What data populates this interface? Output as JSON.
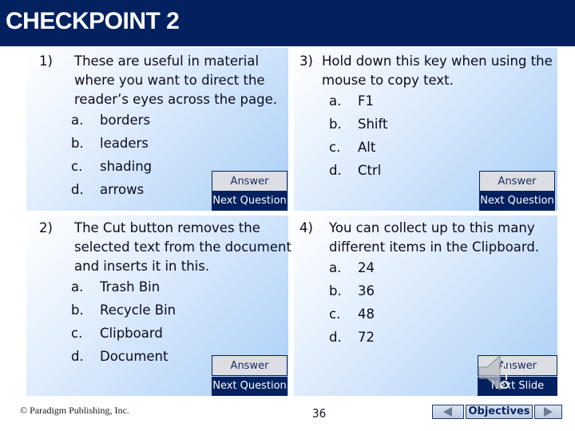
{
  "header": {
    "title": "CHECKPOINT 2"
  },
  "questions": [
    {
      "number": "1)",
      "lines": [
        "These are useful in material",
        "where you want to direct the",
        "reader’s eyes across the page."
      ],
      "options": [
        {
          "letter": "a.",
          "text": "borders"
        },
        {
          "letter": "b.",
          "text": "leaders"
        },
        {
          "letter": "c.",
          "text": "shading"
        },
        {
          "letter": "d.",
          "text": "arrows"
        }
      ],
      "answer_label": "Answer",
      "next_label": "Next Question"
    },
    {
      "number": "2)",
      "lines": [
        "The Cut button removes the",
        "selected text from the document",
        "and inserts it in this."
      ],
      "options": [
        {
          "letter": "a.",
          "text": "Trash Bin"
        },
        {
          "letter": "b.",
          "text": "Recycle Bin"
        },
        {
          "letter": "c.",
          "text": "Clipboard"
        },
        {
          "letter": "d.",
          "text": "Document"
        }
      ],
      "answer_label": "Answer",
      "next_label": "Next Question"
    },
    {
      "number": "3)",
      "lines": [
        "Hold down this key when using the",
        "mouse to copy text."
      ],
      "options": [
        {
          "letter": "a.",
          "text": "F1"
        },
        {
          "letter": "b.",
          "text": "Shift"
        },
        {
          "letter": "c.",
          "text": "Alt"
        },
        {
          "letter": "d.",
          "text": "Ctrl"
        }
      ],
      "answer_label": "Answer",
      "next_label": "Next Question"
    },
    {
      "number": "4)",
      "lines": [
        "You can collect up to this many",
        "different items in the Clipboard."
      ],
      "options": [
        {
          "letter": "a.",
          "text": "24"
        },
        {
          "letter": "b.",
          "text": "36"
        },
        {
          "letter": "c.",
          "text": "48"
        },
        {
          "letter": "d.",
          "text": "72"
        }
      ],
      "answer_label": "Answer",
      "next_label": "Next Slide"
    }
  ],
  "footer": {
    "copyright": "© Paradigm Publishing, Inc.",
    "page_number": "36",
    "objectives_label": "Objectives"
  },
  "icons": {
    "speaker": "speaker-icon",
    "prev": "triangle-left-icon",
    "next": "triangle-right-icon"
  }
}
